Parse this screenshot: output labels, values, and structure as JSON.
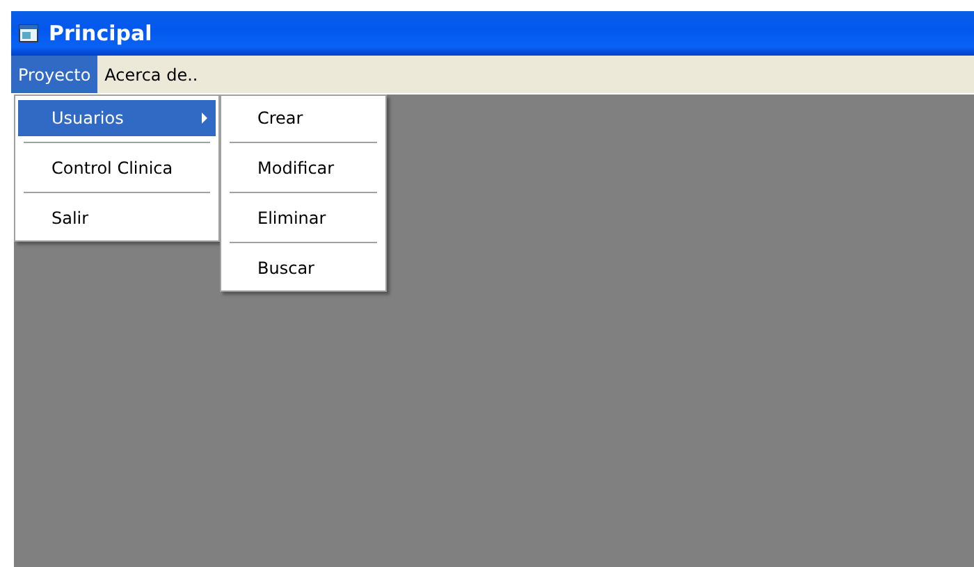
{
  "window": {
    "title": "Principal"
  },
  "menu_bar": [
    {
      "label": "Proyecto",
      "selected": true
    },
    {
      "label": "Acerca de..",
      "selected": false
    }
  ],
  "dropdown": {
    "items": [
      {
        "label": "Usuarios",
        "selected": true,
        "has_submenu": true
      },
      {
        "label": "Control Clinica",
        "selected": false,
        "has_submenu": false
      },
      {
        "label": "Salir",
        "selected": false,
        "has_submenu": false
      }
    ]
  },
  "submenu": {
    "items": [
      {
        "label": "Crear",
        "selected": false
      },
      {
        "label": "Modificar",
        "selected": false
      },
      {
        "label": "Eliminar",
        "selected": false
      },
      {
        "label": "Buscar",
        "selected": false
      }
    ]
  }
}
